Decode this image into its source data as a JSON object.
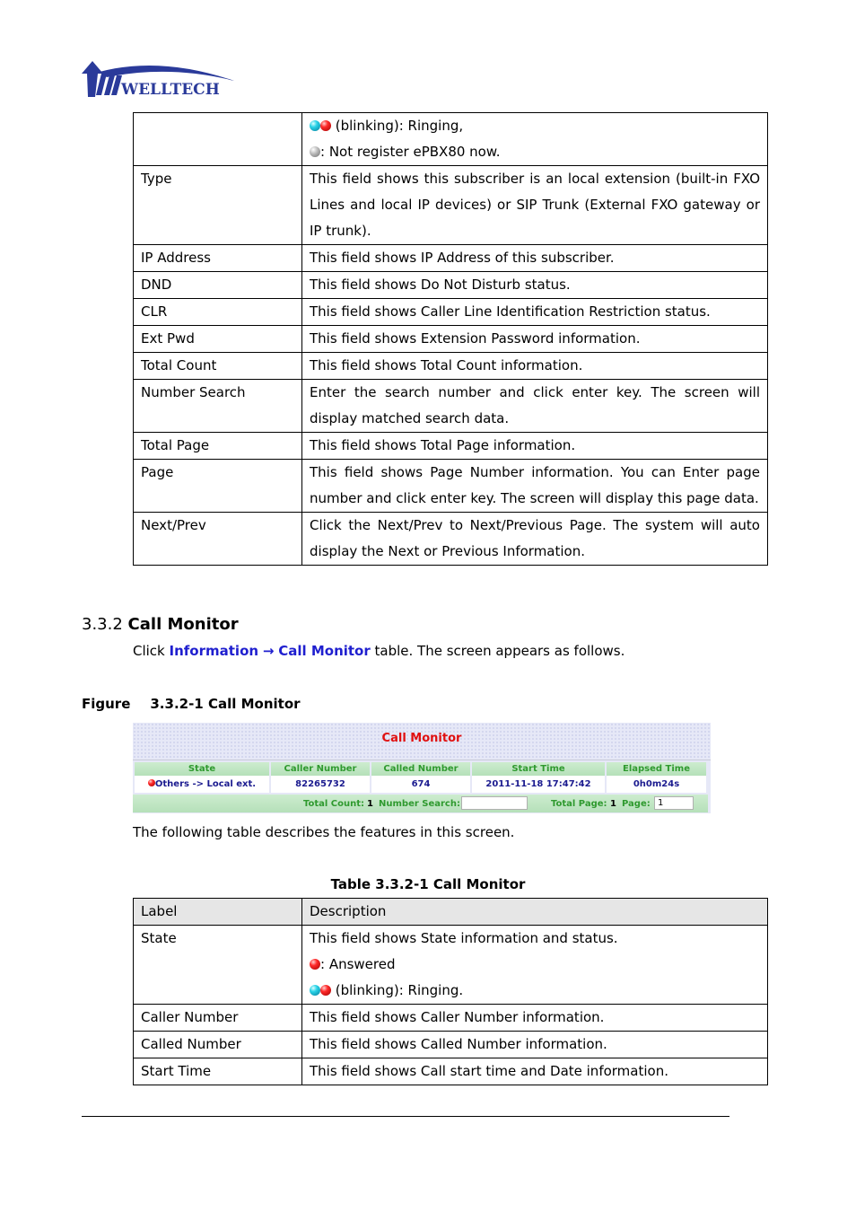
{
  "logo": {
    "brand": "WELLTECH",
    "icon": "welltech-logo-icon"
  },
  "table_top": {
    "rows": [
      {
        "label": "",
        "lines": [
          {
            "icons": [
              "cyan-orb",
              "red-orb"
            ],
            "text": " (blinking): Ringing,"
          },
          {
            "icons": [
              "gray-orb"
            ],
            "text": ": Not register ePBX80 now."
          }
        ]
      },
      {
        "label": "Type",
        "desc": "This field shows this subscriber is an local extension (built-in FXO Lines and local IP devices) or SIP Trunk (External FXO gateway or IP trunk)."
      },
      {
        "label": "IP Address",
        "desc": "This field shows IP Address of this subscriber."
      },
      {
        "label": "DND",
        "desc": "This field shows Do Not Disturb status."
      },
      {
        "label": "CLR",
        "desc": "This field shows Caller Line Identification Restriction status."
      },
      {
        "label": "Ext Pwd",
        "desc": "This field shows Extension Password information."
      },
      {
        "label": "Total Count",
        "desc": "This field shows Total Count information."
      },
      {
        "label": "Number Search",
        "desc": "Enter the search number and click enter key. The screen will display matched search data."
      },
      {
        "label": "Total Page",
        "desc": "This field shows Total Page information."
      },
      {
        "label": "Page",
        "desc": "This field shows Page Number information. You can Enter page number and click enter key. The screen will display this page data."
      },
      {
        "label": "Next/Prev",
        "desc": "Click the Next/Prev to Next/Previous Page. The system will auto display the Next or Previous Information."
      }
    ]
  },
  "section": {
    "number": "3.3.2",
    "title": "Call Monitor",
    "intro_prefix": "Click ",
    "intro_link1": "Information",
    "intro_arrow": "→",
    "intro_link2": "Call Monitor",
    "intro_suffix": " table. The screen appears as follows."
  },
  "figure": {
    "label": "Figure",
    "caption": "3.3.2-1 Call Monitor",
    "screenshot": {
      "title": "Call Monitor",
      "columns": [
        "State",
        "Caller Number",
        "Called Number",
        "Start Time",
        "Elapsed Time"
      ],
      "row": {
        "state_icon": "red-orb",
        "state": "Others -> Local ext.",
        "caller": "82265732",
        "called": "674",
        "start": "2011-11-18 17:47:42",
        "elapsed": "0h0m24s"
      },
      "footer": {
        "total_count_label": "Total Count:",
        "total_count": "1",
        "number_search_label": "Number Search:",
        "number_search_value": "",
        "total_page_label": "Total Page:",
        "total_page": "1",
        "page_label": "Page:",
        "page_value": "1"
      }
    }
  },
  "after_text": "The following table describes the features in this screen.",
  "table_caption": "Table 3.3.2-1 Call Monitor",
  "table_bottom": {
    "header": {
      "label": "Label",
      "desc": "Description"
    },
    "state": {
      "label": "State",
      "line1": "This field shows State information and status.",
      "line2": ": Answered",
      "line3": " (blinking): Ringing."
    },
    "rows": [
      {
        "label": "Caller Number",
        "desc": "This field shows Caller Number information."
      },
      {
        "label": "Called Number",
        "desc": "This field shows Called Number information."
      },
      {
        "label": "Start Time",
        "desc": "This field shows Call start time and Date information."
      }
    ]
  }
}
